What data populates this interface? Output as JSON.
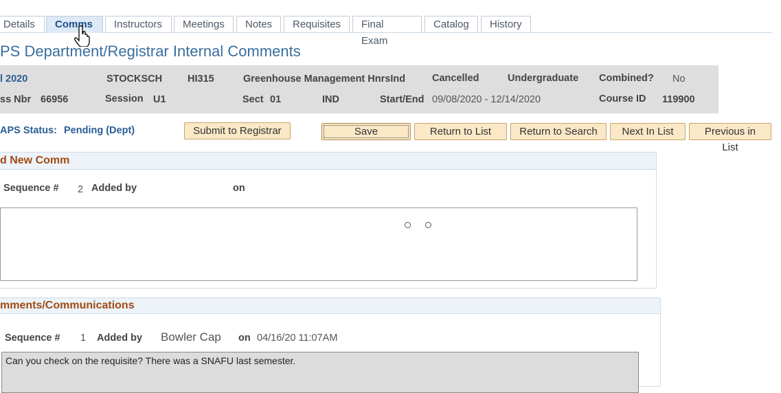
{
  "tabs": [
    "Details",
    "Comms",
    "Instructors",
    "Meetings",
    "Notes",
    "Requisites",
    "Final Exam",
    "Catalog",
    "History"
  ],
  "page_title": "PS Department/Registrar Internal Comments",
  "course": {
    "term": "l 2020",
    "subject": "STOCKSCH",
    "catalog_nbr": "HI315",
    "course_title": "Greenhouse Management HnrsInd",
    "status": "Cancelled",
    "career": "Undergraduate",
    "combined_label": "Combined?",
    "combined_value": "No",
    "class_nbr_label": "ss Nbr",
    "class_nbr_value": "66956",
    "session_label": "Session",
    "session_value": "U1",
    "sect_label": "Sect",
    "sect_value": "01",
    "component": "IND",
    "start_end_label": "Start/End",
    "start_end_value": "09/08/2020 - 12/14/2020",
    "course_id_label": "Course ID",
    "course_id_value": "119900"
  },
  "status": {
    "label": "APS Status:",
    "value": "Pending (Dept)"
  },
  "buttons": {
    "submit": "Submit to Registrar",
    "save": "Save",
    "return_list": "Return to List",
    "return_search": "Return to Search",
    "next": "Next In List",
    "previous": "Previous in List"
  },
  "new_comm": {
    "header": "d New Comm",
    "seq_label": "Sequence #",
    "seq_value": "2",
    "added_by_label": "Added by",
    "added_by_value": "",
    "on_label": "on",
    "text": ""
  },
  "comments": {
    "header": "mments/Communications",
    "items": [
      {
        "seq_label": "Sequence #",
        "seq_value": "1",
        "added_by_label": "Added by",
        "added_by_value": "Bowler Cap",
        "on_label": "on",
        "on_value": "04/16/20 11:07AM",
        "text": "Can you check on the requisite? There was a SNAFU last semester."
      }
    ]
  }
}
